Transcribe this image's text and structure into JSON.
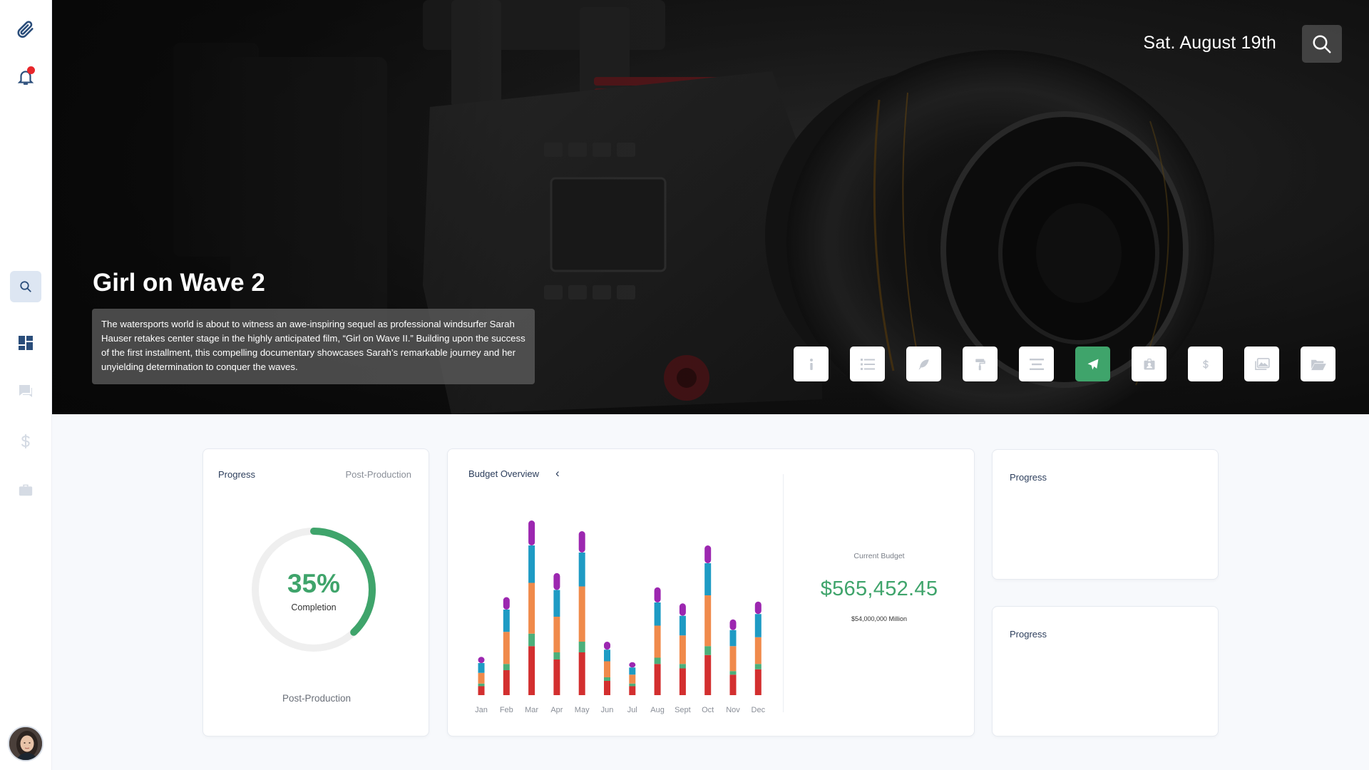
{
  "app": {
    "date": "Sat. August 19th"
  },
  "sidebar": {
    "icons": [
      "paperclip-icon",
      "bell-icon",
      "search-icon",
      "dashboard-icon",
      "chat-icon",
      "dollar-icon",
      "briefcase-icon"
    ],
    "has_notification": true
  },
  "hero": {
    "title": "Girl on Wave 2",
    "description": "The watersports world is about to witness an awe-inspiring sequel as professional windsurfer Sarah Hauser retakes center stage in the highly anticipated film, “Girl on Wave II.” Building upon the success of the first installment, this compelling documentary showcases Sarah’s remarkable journey and her unyielding determination to conquer the waves.",
    "tools": [
      "info-icon",
      "checklist-icon",
      "feather-icon",
      "paint-roller-icon",
      "align-icon",
      "send-icon",
      "id-badge-icon",
      "dollar-icon",
      "images-icon",
      "folder-open-icon"
    ],
    "active_tool": "send-icon"
  },
  "progress_card": {
    "label": "Progress",
    "stage": "Post-Production",
    "percent_text": "35%",
    "percent_value": 0.35,
    "completion_label": "Completion",
    "footer": "Post-Production"
  },
  "budget_card": {
    "label": "Budget Overview",
    "back_chevron": "‹",
    "current_budget_label": "Current Budget",
    "current_budget_value": "$565,452.45",
    "total_label": "$54,000,000 Million"
  },
  "chart_data": {
    "type": "bar",
    "stacked": true,
    "categories": [
      "Jan",
      "Feb",
      "Mar",
      "Apr",
      "May",
      "Jun",
      "Jul",
      "Aug",
      "Sept",
      "Oct",
      "Nov",
      "Dec"
    ],
    "series": [
      {
        "color": "#d32f2f",
        "values": [
          10,
          28,
          55,
          40,
          48,
          16,
          10,
          35,
          30,
          45,
          23,
          29
        ]
      },
      {
        "color": "#4caf7a",
        "values": [
          3,
          7,
          14,
          8,
          12,
          4,
          3,
          7,
          5,
          10,
          4,
          6
        ]
      },
      {
        "color": "#f08a4b",
        "values": [
          12,
          36,
          57,
          40,
          62,
          18,
          10,
          36,
          32,
          57,
          28,
          30
        ]
      },
      {
        "color": "#1e9bc4",
        "values": [
          11,
          25,
          42,
          30,
          38,
          13,
          8,
          26,
          22,
          36,
          18,
          26
        ]
      },
      {
        "color": "#9c27b0",
        "values": [
          7,
          14,
          28,
          19,
          24,
          9,
          6,
          17,
          14,
          20,
          12,
          14
        ]
      }
    ]
  },
  "side_cards": [
    {
      "label": "Progress"
    },
    {
      "label": "Progress"
    }
  ],
  "colors": {
    "accent": "#3fa46b",
    "notification": "#e8262b",
    "primary_text": "#2c3e5c"
  }
}
